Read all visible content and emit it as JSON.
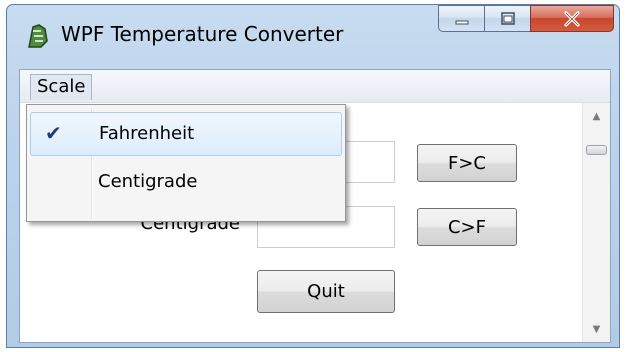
{
  "window": {
    "title": "WPF Temperature Converter",
    "icon": "app-icon",
    "caption_buttons": {
      "minimize_glyph": "—",
      "maximize_glyph": "□",
      "close_glyph": "X"
    }
  },
  "menubar": {
    "items": [
      {
        "label": "Scale"
      }
    ]
  },
  "form": {
    "centigrade_label": "Centigrade",
    "buttons": {
      "f_to_c": "F>C",
      "c_to_f": "C>F",
      "quit": "Quit"
    }
  },
  "scale_menu": {
    "items": [
      {
        "label": "Fahrenheit",
        "checked": true
      },
      {
        "label": "Centigrade",
        "checked": false
      }
    ],
    "check_glyph": "✔"
  },
  "scrollbar": {
    "up_glyph": "▲",
    "down_glyph": "▼"
  },
  "colors": {
    "menu_highlight": "#dcecfc",
    "check_color": "#1e3b7a",
    "close_button": "#c7462f"
  }
}
